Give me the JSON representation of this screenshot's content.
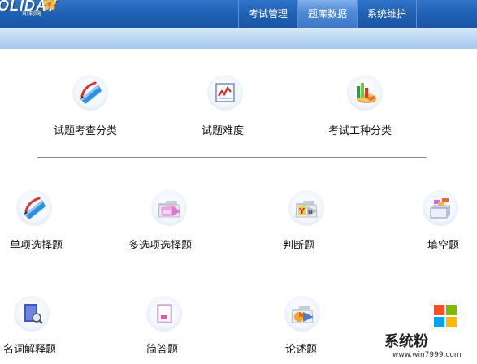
{
  "header": {
    "logo_text": "OLIDAY",
    "logo_sub": "和利嗨",
    "nav": [
      {
        "label": "考试管理",
        "active": false
      },
      {
        "label": "题库数据",
        "active": true
      },
      {
        "label": "系统维护",
        "active": false
      }
    ]
  },
  "row1": [
    {
      "label": "试题考查分类",
      "icon": "pencil-ruler-icon"
    },
    {
      "label": "试题难度",
      "icon": "line-chart-icon"
    },
    {
      "label": "考试工种分类",
      "icon": "bar-pie-chart-icon"
    }
  ],
  "row2": [
    {
      "label": "单项选择题",
      "icon": "pencil-ruler-icon"
    },
    {
      "label": "多选项选择题",
      "icon": "folder-icon"
    },
    {
      "label": "判断题",
      "icon": "yes-no-folder-icon"
    },
    {
      "label": "填空题",
      "icon": "blocks-icon"
    }
  ],
  "row3": [
    {
      "label": "名词解释题",
      "icon": "document-search-icon"
    },
    {
      "label": "简答题",
      "icon": "note-icon"
    },
    {
      "label": "论述题",
      "icon": "chart-folder-icon"
    }
  ],
  "watermark": {
    "text": "系统粉",
    "url": "www.win7999.com",
    "colors": [
      "#f25022",
      "#7fba00",
      "#00a4ef",
      "#ffb900"
    ]
  }
}
